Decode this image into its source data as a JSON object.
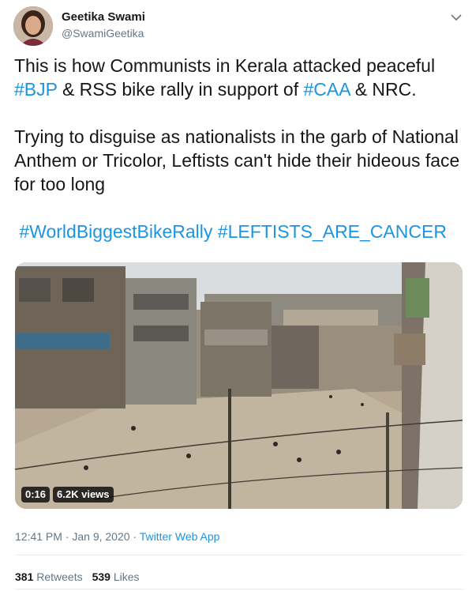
{
  "author": {
    "name": "Geetika Swami",
    "handle": "@SwamiGeetika"
  },
  "tweet": {
    "line1_a": "This is how Communists in Kerala attacked peaceful",
    "line2_tag1": "#BJP",
    "line2_b": " & RSS bike rally in support of ",
    "line2_tag2": "#CAA",
    "line2_c": " & NRC.",
    "line3": "Trying to disguise as nationalists in the garb of National",
    "line4": "Anthem or Tricolor, Leftists can't hide their hideous face",
    "line5": "for too long",
    "hashtag_a": "#WorldBiggestBikeRally",
    "hashtag_b": "#LEFTISTS_ARE_CANCER"
  },
  "media": {
    "duration": "0:16",
    "views": "6.2K views"
  },
  "meta": {
    "time": "12:41 PM · Jan 9, 2020 · ",
    "source": "Twitter Web App"
  },
  "stats": {
    "retweets_count": "381",
    "retweets_label": "Retweets",
    "likes_count": "539",
    "likes_label": "Likes"
  },
  "icons": {
    "caret": "chevron-down-icon"
  },
  "colors": {
    "link": "#1b95e0",
    "secondary_text": "#657786",
    "primary_text": "#14171a"
  }
}
